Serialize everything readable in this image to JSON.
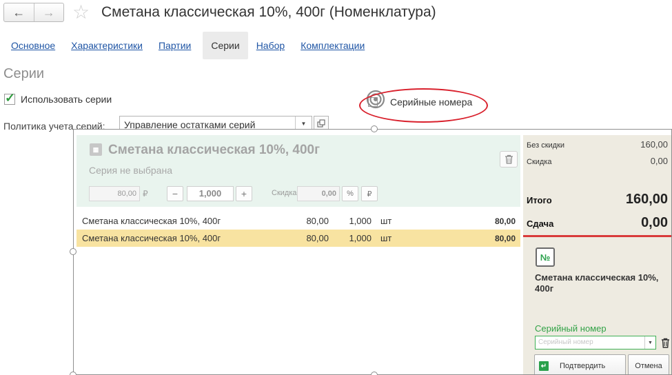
{
  "window": {
    "title": "Сметана классическая 10%, 400г (Номенклатура)",
    "back_icon": "←",
    "forward_icon": "→",
    "star_icon": "☆"
  },
  "tabs": [
    {
      "label": "Основное"
    },
    {
      "label": "Характеристики"
    },
    {
      "label": "Партии"
    },
    {
      "label": "Серии",
      "active": true
    },
    {
      "label": "Набор"
    },
    {
      "label": "Комплектации"
    }
  ],
  "section": {
    "title": "Серии",
    "use_series_label": "Использовать серии",
    "use_series_checked": true,
    "serial_numbers_label": "Серийные номера",
    "serial_numbers_checked": false,
    "policy_label": "Политика учета серий:",
    "policy_value": "Управление остатками серий"
  },
  "pos": {
    "card": {
      "product_title": "Сметана классическая 10%, 400г",
      "series_status": "Серия не выбрана",
      "price": "80,00",
      "currency": "₽",
      "minus": "−",
      "quantity": "1,000",
      "plus": "+",
      "discount_label": "Скидка",
      "discount_value": "0,00",
      "percent_btn": "%",
      "rub_btn": "₽"
    },
    "rows": [
      {
        "name": "Сметана классическая 10%, 400г",
        "price": "80,00",
        "qty": "1,000",
        "unit": "шт",
        "sum": "80,00",
        "selected": false
      },
      {
        "name": "Сметана классическая 10%, 400г",
        "price": "80,00",
        "qty": "1,000",
        "unit": "шт",
        "sum": "80,00",
        "selected": true
      }
    ],
    "summary": {
      "no_discount_label": "Без скидки",
      "no_discount_value": "160,00",
      "discount_label": "Скидка",
      "discount_value": "0,00",
      "total_label": "Итого",
      "total_value": "160,00",
      "change_label": "Сдача",
      "change_value": "0,00"
    },
    "serial_panel": {
      "badge": "№",
      "product": "Сметана классическая 10%, 400г",
      "serial_label": "Серийный номер",
      "serial_placeholder": "Серийный номер",
      "confirm_label": "Подтвердить",
      "cancel_label": "Отмена"
    }
  },
  "colors": {
    "link": "#1f55a5",
    "accent_green": "#2aa14b",
    "highlight_row": "#f8e3a1",
    "card_bg": "#e9f4ee",
    "side_bg": "#eeebe1",
    "annotation_red": "#d9202c"
  }
}
